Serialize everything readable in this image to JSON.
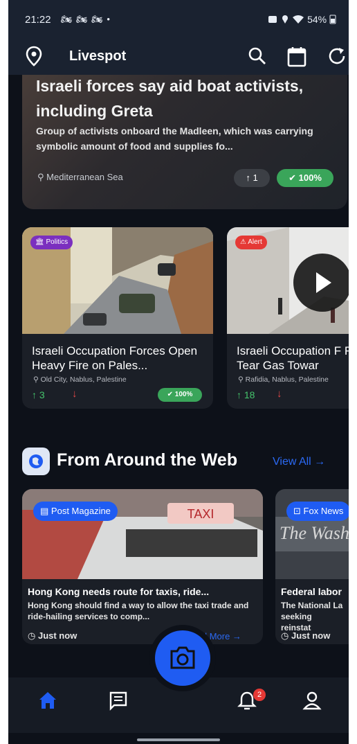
{
  "status": {
    "time": "21:22",
    "left_icons": "🏍 🏍 🏍 •",
    "right_text": "54%"
  },
  "appbar": {
    "title": "Livespot",
    "icons": [
      "location-pin-icon",
      "search-icon",
      "calendar-icon",
      "refresh-icon"
    ]
  },
  "hero": {
    "title": "Israeli forces say aid boat activists, including Greta",
    "summary": "Group of activists onboard the Madleen, which was carrying symbolic amount of food and supplies fo...",
    "location": "Mediterranean Sea",
    "upvotes": "1",
    "verified": "100%"
  },
  "news_cards": [
    {
      "tag": "Politics",
      "tag_color": "#7b2fbf",
      "headline": "Israeli Occupation Forces Open Heavy Fire on Pales...",
      "location": "Old City, Nablus, Palestine",
      "upvotes": "3",
      "verified": "100%"
    },
    {
      "tag": "Alert",
      "tag_color": "#e53935",
      "headline": "Israeli Occupation F Fire Tear Gas Towar",
      "location": "Rafidia, Nablus, Palestine",
      "upvotes": "18"
    }
  ],
  "section": {
    "title": "From Around the Web",
    "view_all": "View All →"
  },
  "web_cards": [
    {
      "source": "Post Magazine",
      "photo_text": "TAXI",
      "title": "Hong Kong needs route for taxis, ride...",
      "summary": "Hong Kong should find a way to allow the taxi trade and ride-hailing services to comp...",
      "time": "Just now",
      "read_more": "Read More →"
    },
    {
      "source": "Fox News",
      "photo_text": "The Washington",
      "title": "Federal labor",
      "summary": "The National La seeking reinstat",
      "time": "Just now"
    }
  ],
  "bottom_nav": {
    "items": [
      "home-icon",
      "chat-icon",
      "camera-icon",
      "notifications-icon",
      "profile-icon"
    ],
    "notification_count": "2"
  },
  "colors": {
    "accent": "#1f5cf2",
    "background": "#0d1119",
    "verified_green": "#3aa55a",
    "upvote_green": "#45c46c",
    "downvote_red": "#e54848"
  }
}
